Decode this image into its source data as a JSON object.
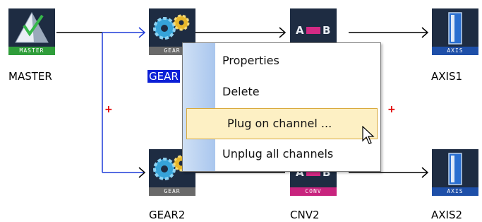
{
  "nodes": {
    "master": {
      "badge": "MASTER",
      "caption": "MASTER",
      "icon": "master-triangle-icon"
    },
    "gear1": {
      "badge": "GEAR",
      "caption": "GEAR",
      "icon": "gears-icon"
    },
    "conv1": {
      "badge_a": "A",
      "badge_b": "B",
      "icon": "converter-ab-icon"
    },
    "axis1": {
      "badge": "AXIS",
      "caption": "AXIS1",
      "icon": "axis-device-icon"
    },
    "gear2": {
      "badge": "GEAR",
      "caption": "GEAR2",
      "icon": "gears-icon"
    },
    "conv2": {
      "badge": "CONV",
      "badge_a": "A",
      "badge_b": "B",
      "caption": "CNV2",
      "icon": "converter-ab-icon"
    },
    "axis2": {
      "badge": "AXIS",
      "caption": "AXIS2",
      "icon": "axis-device-icon"
    }
  },
  "junction_marks": [
    "+",
    "+"
  ],
  "context_menu": {
    "items": [
      {
        "label": "Properties"
      },
      {
        "label": "Delete"
      },
      {
        "label": "Plug on channel ...",
        "highlighted": true
      },
      {
        "label": "Unplug all channels"
      }
    ]
  },
  "colors": {
    "selection": "#0b1fd6",
    "wire_blue": "#1f3bd8",
    "wire_black": "#000000",
    "menu_highlight": "#fdf0c4",
    "plus_mark": "#e00000"
  }
}
